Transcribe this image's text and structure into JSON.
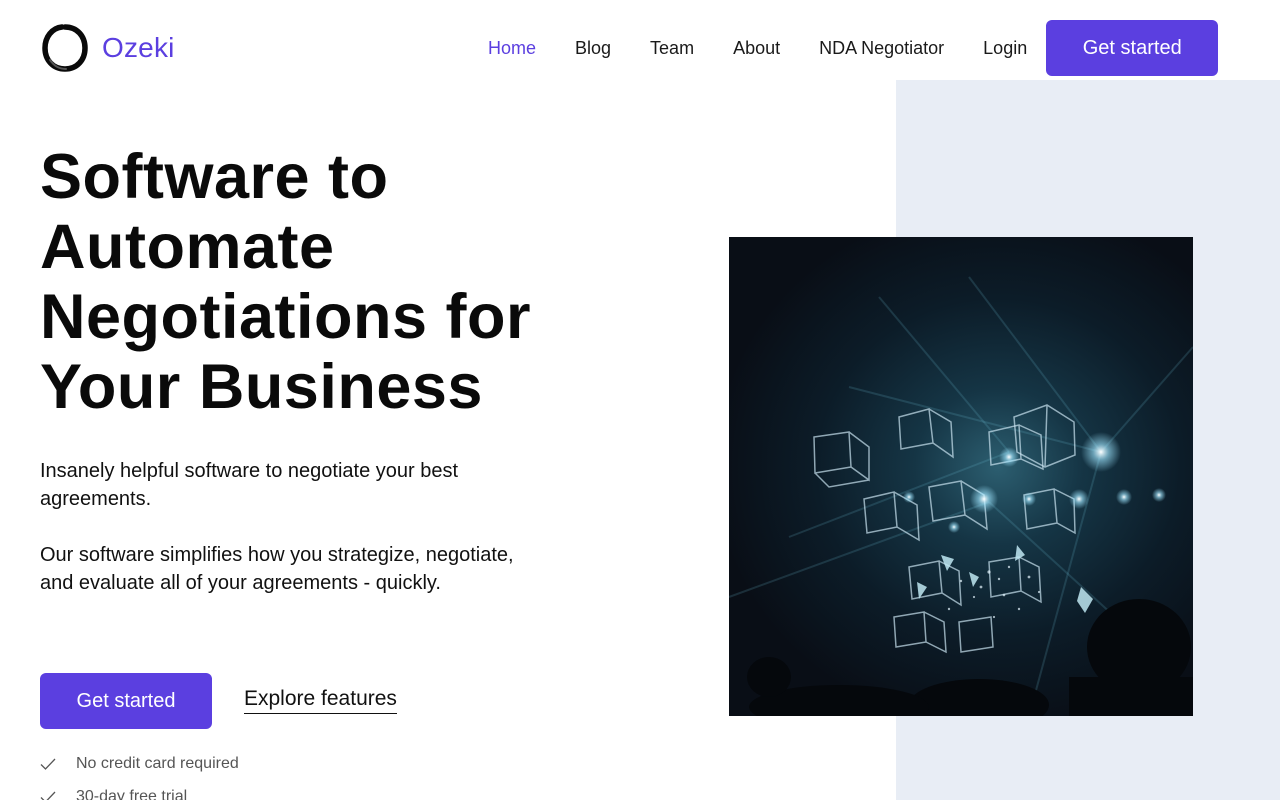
{
  "brand": {
    "name": "Ozeki",
    "logo_icon": "enso-circle-icon",
    "accent": "#5b3fe0"
  },
  "nav": {
    "items": [
      {
        "label": "Home",
        "active": true
      },
      {
        "label": "Blog",
        "active": false
      },
      {
        "label": "Team",
        "active": false
      },
      {
        "label": "About",
        "active": false
      },
      {
        "label": "NDA Negotiator",
        "active": false
      },
      {
        "label": "Login",
        "active": false
      }
    ],
    "cta_label": "Get started"
  },
  "hero": {
    "title_lines": [
      "Software to",
      "Automate",
      "Negotiations for",
      "Your Business"
    ],
    "lead": "Insanely helpful software to negotiate your best agreements.",
    "description": "Our software simplifies how you strategize, negotiate, and evaluate all of your agreements - quickly.",
    "primary_cta": "Get started",
    "secondary_cta": "Explore features",
    "perks": [
      {
        "icon": "check-icon",
        "label": "No credit card required"
      },
      {
        "icon": "check-icon",
        "label": "30-day free trial"
      }
    ]
  },
  "colors": {
    "side_panel": "#e8edf5",
    "text": "#111111",
    "muted": "#555555"
  }
}
